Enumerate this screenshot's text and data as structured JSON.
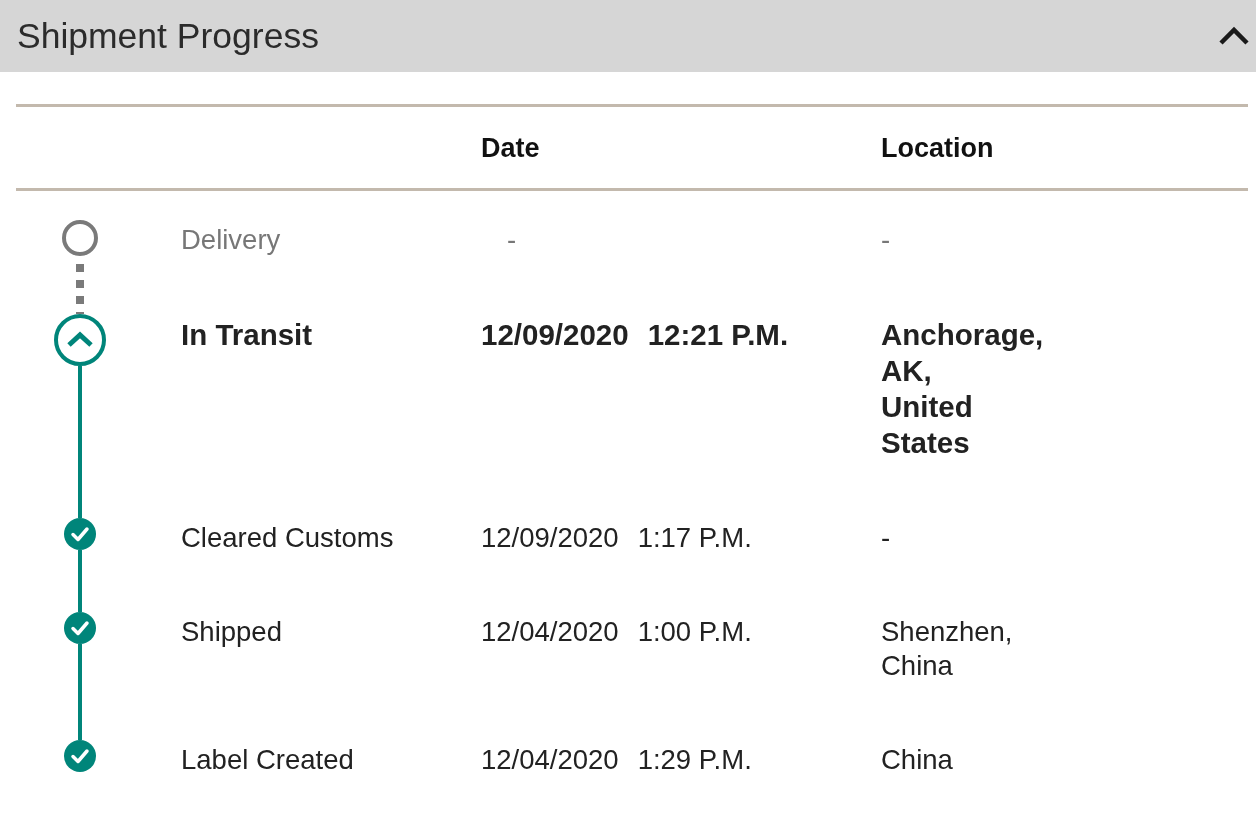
{
  "panel": {
    "title": "Shipment Progress",
    "expanded": true
  },
  "table": {
    "columns": [
      "Date",
      "Location"
    ],
    "events": [
      {
        "kind": "pending",
        "label": "Delivery",
        "date": "-",
        "location": "-"
      },
      {
        "kind": "current",
        "label": "In Transit",
        "date": "12/09/2020",
        "time": "12:21 P.M.",
        "location": "Anchorage, AK, United States"
      },
      {
        "kind": "done",
        "label": "Cleared Customs",
        "date": "12/09/2020",
        "time": "1:17 P.M.",
        "location": "-"
      },
      {
        "kind": "done",
        "label": "Shipped",
        "date": "12/04/2020",
        "time": "1:00 P.M.",
        "location": "Shenzhen, China"
      },
      {
        "kind": "done",
        "label": "Label Created",
        "date": "12/04/2020",
        "time": "1:29 P.M.",
        "location": "China"
      }
    ]
  }
}
